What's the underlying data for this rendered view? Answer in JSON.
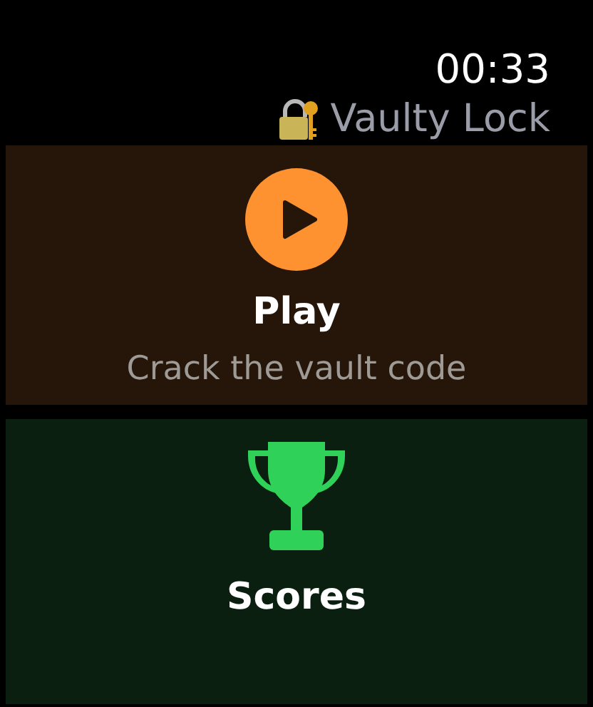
{
  "status_bar": {
    "time": "00:33"
  },
  "app_title": "Vaulty Lock",
  "menu": [
    {
      "kind": "play",
      "label": "Play",
      "subtitle": "Crack the vault code",
      "color": "#ff9230"
    },
    {
      "kind": "scores",
      "label": "Scores",
      "color": "#30d158"
    }
  ]
}
